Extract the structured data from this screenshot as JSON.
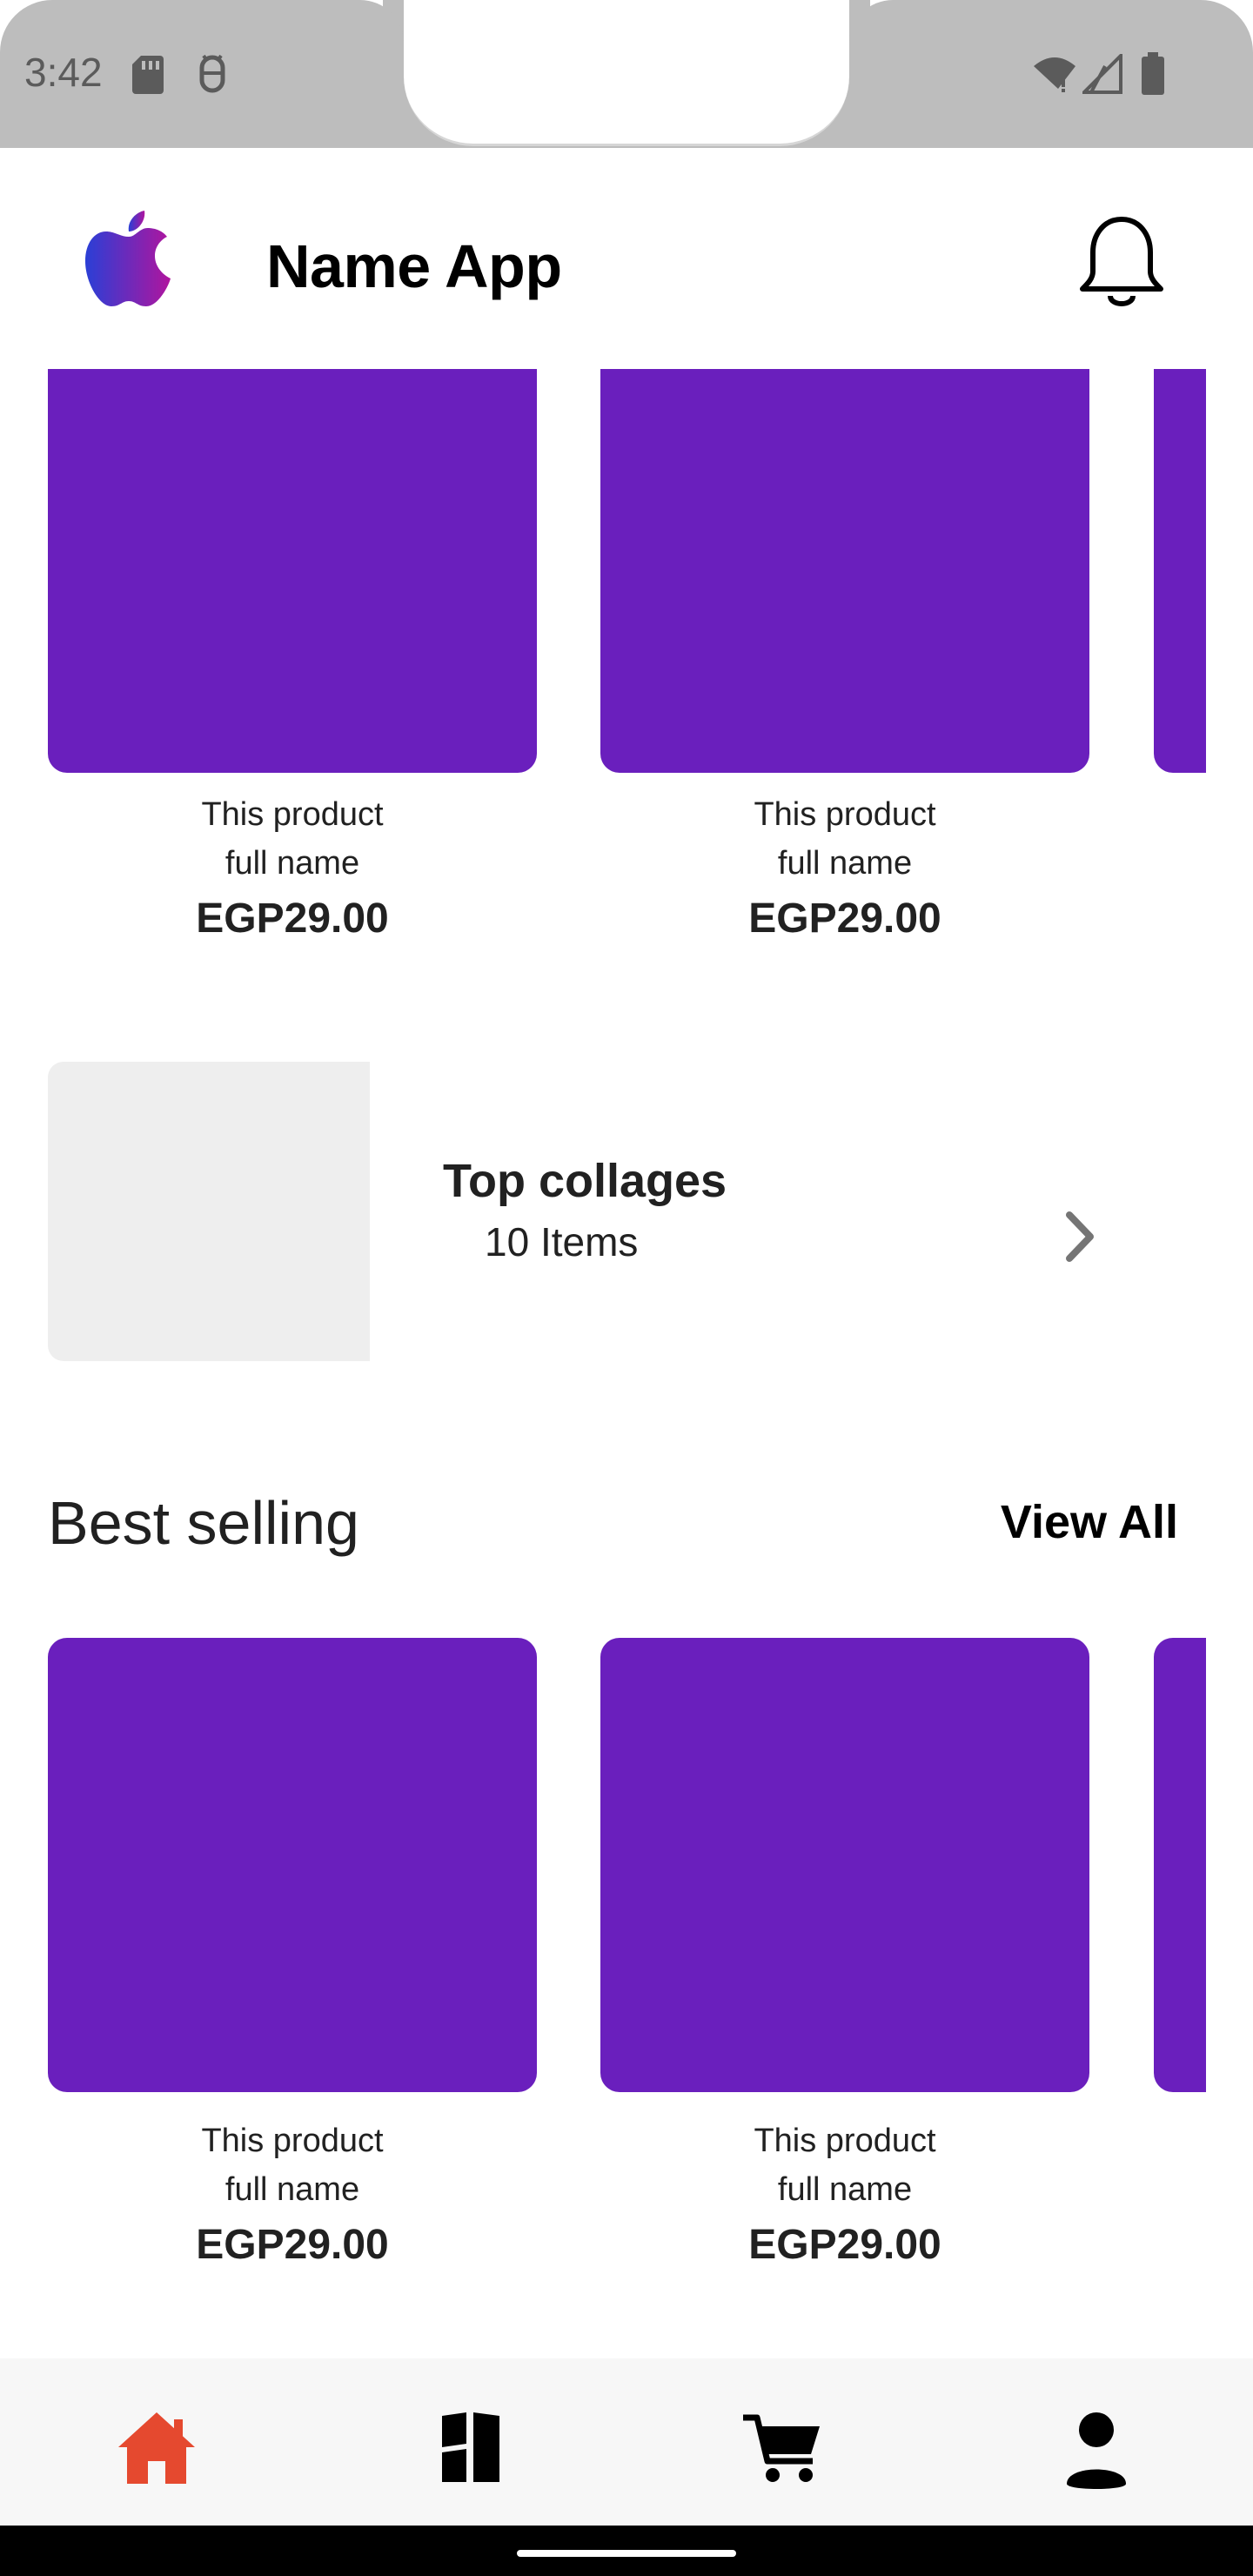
{
  "status_bar": {
    "time": "3:42",
    "left_icons": [
      "sd-card-icon",
      "android-debug-icon"
    ],
    "right_icons": [
      "wifi-icon",
      "signal-icon",
      "battery-icon"
    ]
  },
  "header": {
    "title": "Name App",
    "logo_icon": "apple-logo-icon",
    "action_icon": "bell-icon"
  },
  "featured_products": [
    {
      "name": "This product full name",
      "price": "EGP29.00"
    },
    {
      "name": "This product full name",
      "price": "EGP29.00"
    }
  ],
  "collage": {
    "title": "Top collages",
    "count": "10 Items"
  },
  "best_selling": {
    "title": "Best selling",
    "view_all": "View All",
    "products": [
      {
        "name": "This product full name",
        "price": "EGP29.00"
      },
      {
        "name": "This product full name",
        "price": "EGP29.00"
      }
    ]
  },
  "bottom_nav": {
    "items": [
      {
        "icon": "home-icon",
        "active": true
      },
      {
        "icon": "categories-icon",
        "active": false
      },
      {
        "icon": "cart-icon",
        "active": false
      },
      {
        "icon": "profile-icon",
        "active": false
      }
    ],
    "active_color": "#e5492f",
    "inactive_color": "#000000"
  },
  "colors": {
    "card": "#6a1fbd",
    "placeholder": "#eeeeee",
    "status_bar": "#bdbdbd",
    "text": "#212121"
  }
}
